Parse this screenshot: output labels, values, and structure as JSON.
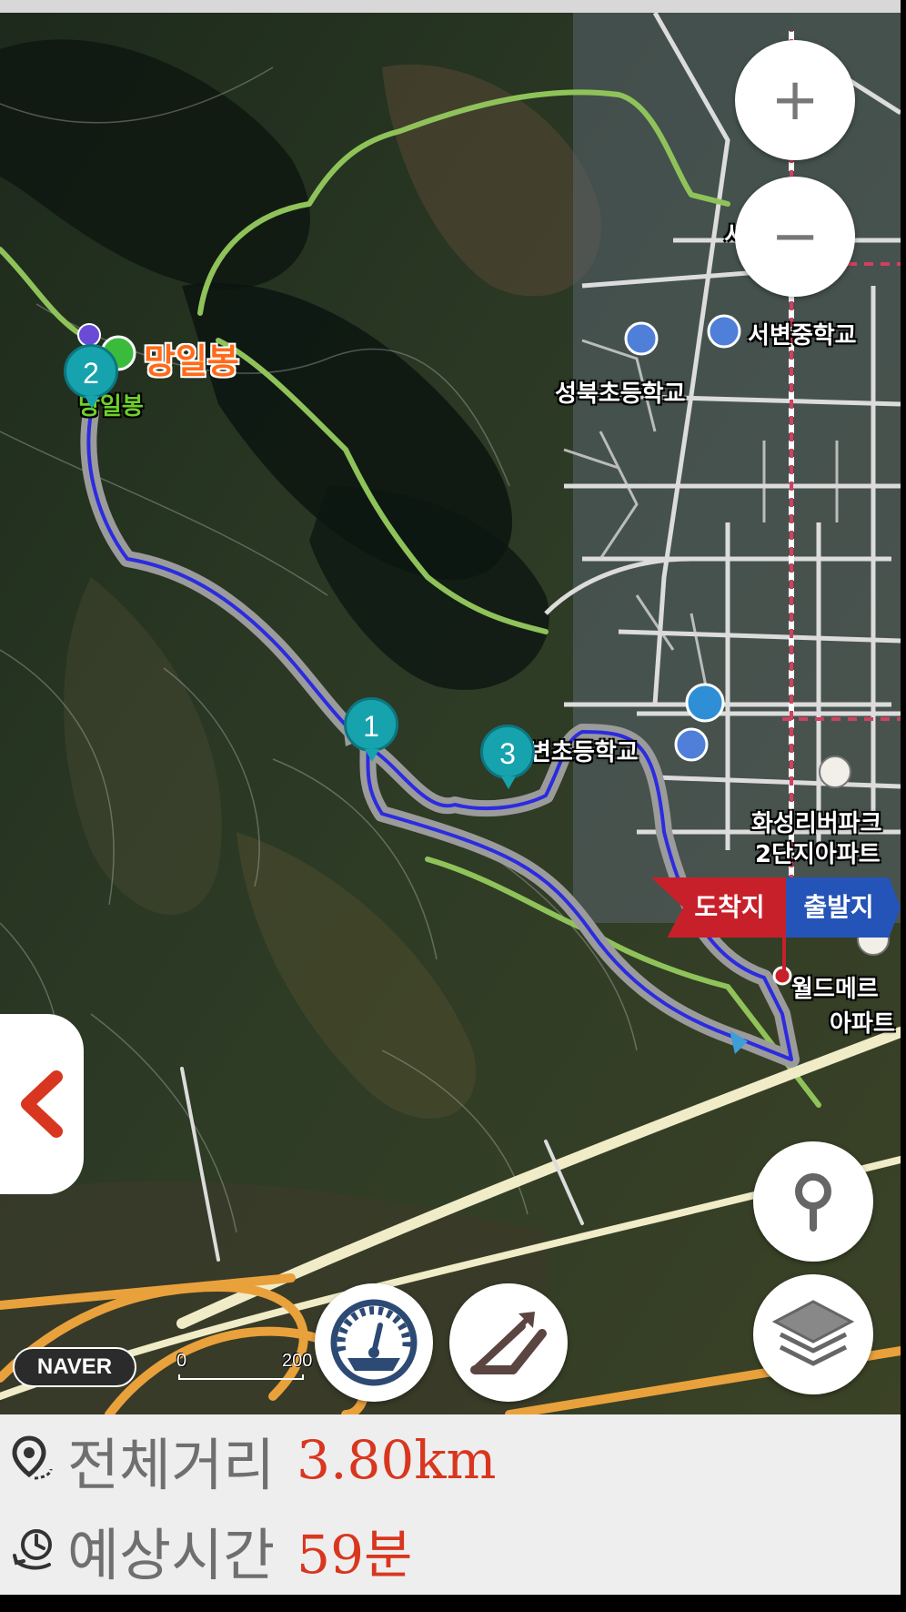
{
  "map": {
    "places": {
      "peak": "망일봉",
      "peak_sub": "망일봉",
      "school_1": "서변중학교",
      "school_2": "성북초등학교",
      "school_3": "변초등학교",
      "apartment_1_line1": "화성리버파크",
      "apartment_1_line2": "2단지아파트",
      "apartment_2_line1": "월드메르",
      "apartment_2_line2": "아파트",
      "partial_top": "서"
    },
    "waypoints": [
      "1",
      "2",
      "3"
    ],
    "flags": {
      "arrival": "도착지",
      "departure": "출발지"
    },
    "scale": {
      "start": "0",
      "end": "200"
    },
    "provider": "NAVER"
  },
  "controls": {
    "zoom_in_icon": "plus-icon",
    "zoom_out_icon": "minus-icon",
    "back_icon": "chevron-left-icon",
    "speed_icon": "speedometer-icon",
    "elevation_icon": "elevation-icon",
    "location_icon": "location-pin-icon",
    "layers_icon": "layers-icon"
  },
  "summary": {
    "distance_label": "전체거리",
    "distance_value": "3.80km",
    "time_label": "예상시간",
    "time_value": "59분"
  },
  "colors": {
    "route": "#2b2be0",
    "trail": "#8fc35a",
    "waypoint": "#17a3ad",
    "accent": "#d9361f",
    "arrival_flag": "#c8202a",
    "departure_flag": "#2554b8"
  }
}
